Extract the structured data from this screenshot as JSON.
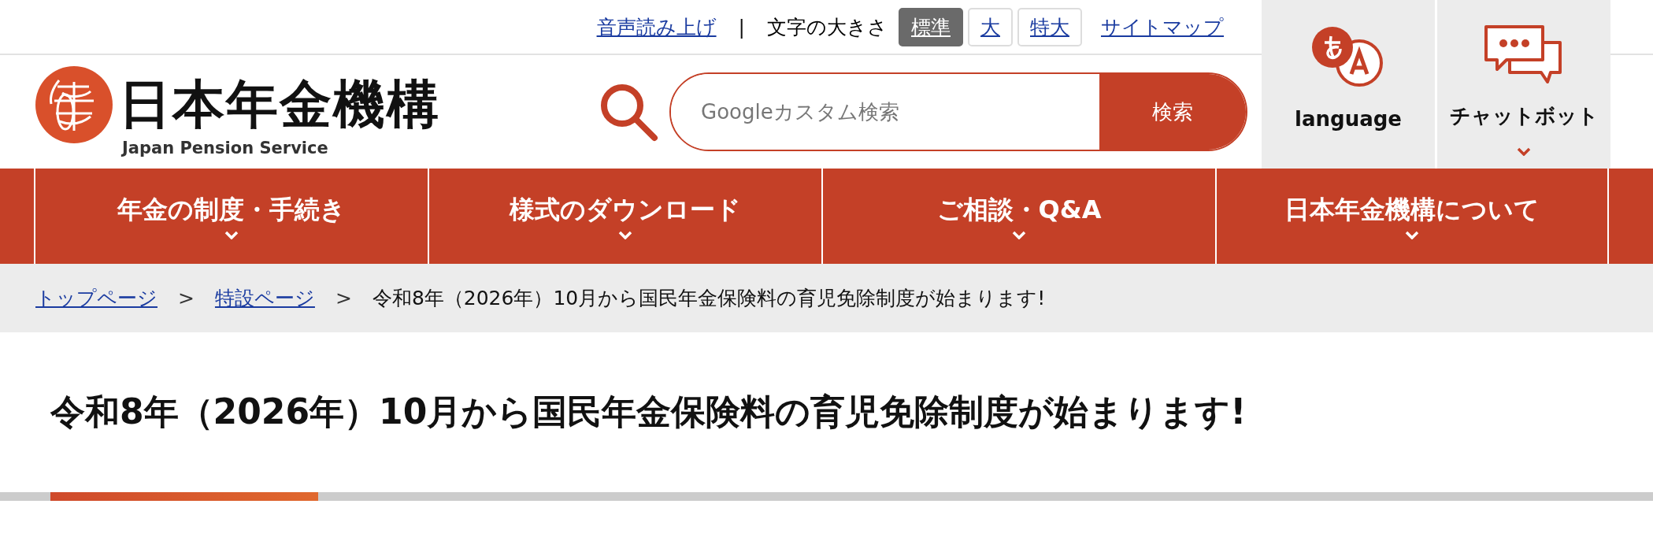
{
  "utility": {
    "read_aloud": "音声読み上げ",
    "separator": "|",
    "font_size": {
      "label": "文字の大きさ",
      "options": [
        {
          "label": "標準",
          "selected": true
        },
        {
          "label": "大",
          "selected": false
        },
        {
          "label": "特大",
          "selected": false
        }
      ]
    },
    "sitemap": "サイトマップ"
  },
  "logo": {
    "name": "日本年金機構",
    "subtitle": "Japan Pension Service"
  },
  "search": {
    "placeholder": "Googleカスタム検索",
    "button": "検索"
  },
  "side_buttons": [
    {
      "kind": "language",
      "label": "language"
    },
    {
      "kind": "chat",
      "label": "チャットボット"
    }
  ],
  "nav": [
    {
      "label": "年金の制度・手続き"
    },
    {
      "label": "様式のダウンロード"
    },
    {
      "label": "ご相談・Q&A"
    },
    {
      "label": "日本年金機構について"
    }
  ],
  "breadcrumb": {
    "separator": ">",
    "links": [
      "トップページ",
      "特設ページ"
    ],
    "current": "令和8年（2026年）10月から国民年金保険料の育児免除制度が始まります!"
  },
  "page_title": "令和8年（2026年）10月から国民年金保険料の育児免除制度が始まります!"
}
